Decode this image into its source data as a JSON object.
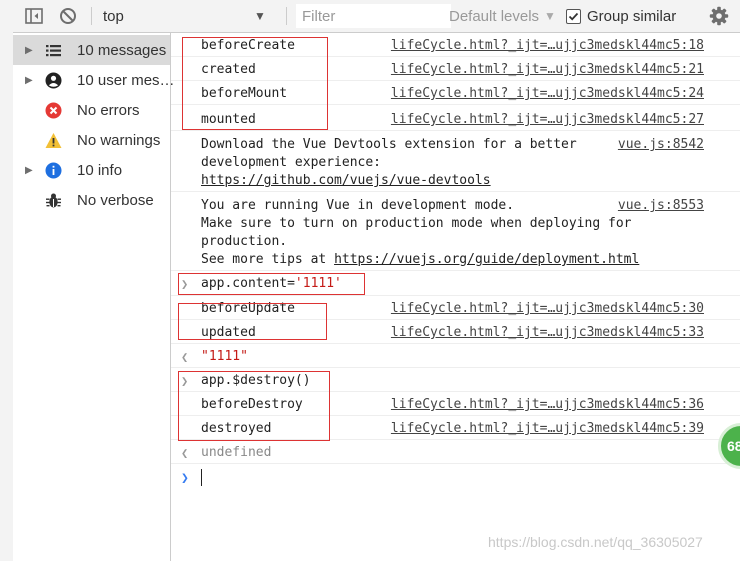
{
  "toolbar": {
    "context": "top",
    "filter_placeholder": "Filter",
    "levels": "Default levels",
    "group_similar": "Group similar",
    "group_similar_checked": true
  },
  "sidebar": {
    "items": [
      {
        "label": "10 messages",
        "icon": "list-icon",
        "expandable": true,
        "selected": true
      },
      {
        "label": "10 user mes…",
        "icon": "user-icon",
        "expandable": true,
        "selected": false
      },
      {
        "label": "No errors",
        "icon": "error-icon",
        "expandable": false,
        "selected": false
      },
      {
        "label": "No warnings",
        "icon": "warning-icon",
        "expandable": false,
        "selected": false
      },
      {
        "label": "10 info",
        "icon": "info-icon",
        "expandable": true,
        "selected": false
      },
      {
        "label": "No verbose",
        "icon": "bug-icon",
        "expandable": false,
        "selected": false
      }
    ]
  },
  "console": {
    "logs": [
      {
        "text": "beforeCreate",
        "source": "lifeCycle.html?_ijt=…ujjc3medskl44mc5:18"
      },
      {
        "text": "created",
        "source": "lifeCycle.html?_ijt=…ujjc3medskl44mc5:21"
      },
      {
        "text": "beforeMount",
        "source": "lifeCycle.html?_ijt=…ujjc3medskl44mc5:24"
      },
      {
        "text": "mounted",
        "source": "lifeCycle.html?_ijt=…ujjc3medskl44mc5:27"
      }
    ],
    "devtools_msg": {
      "line1": "Download the Vue Devtools extension for a better",
      "line2": "development experience:",
      "link": "https://github.com/vuejs/vue-devtools",
      "source": "vue.js:8542"
    },
    "devmode_msg": {
      "line1": "You are running Vue in development mode.",
      "line2": "Make sure to turn on production mode when deploying for",
      "line3": "production.",
      "line4_prefix": "See more tips at ",
      "link": "https://vuejs.org/guide/deployment.html",
      "source": "vue.js:8553"
    },
    "input1": {
      "prefix": "app.content=",
      "value": "'1111'"
    },
    "update_logs": [
      {
        "text": "beforeUpdate",
        "source": "lifeCycle.html?_ijt=…ujjc3medskl44mc5:30"
      },
      {
        "text": "updated",
        "source": "lifeCycle.html?_ijt=…ujjc3medskl44mc5:33"
      }
    ],
    "result1": "\"1111\"",
    "input2": "app.$destroy()",
    "destroy_logs": [
      {
        "text": "beforeDestroy",
        "source": "lifeCycle.html?_ijt=…ujjc3medskl44mc5:36"
      },
      {
        "text": "destroyed",
        "source": "lifeCycle.html?_ijt=…ujjc3medskl44mc5:39"
      }
    ],
    "result2": "undefined"
  },
  "badge_text": "68",
  "watermark": "https://blog.csdn.net/qq_36305027"
}
